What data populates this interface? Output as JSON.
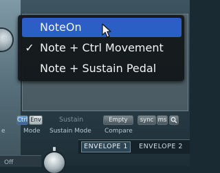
{
  "left_panel": {
    "partial_label": "od"
  },
  "sustain_menu": {
    "items": [
      {
        "label": "NoteOn",
        "checked": false,
        "highlighted": true
      },
      {
        "label": "Note + Ctrl Movement",
        "checked": true,
        "highlighted": false
      },
      {
        "label": "Note + Sustain Pedal",
        "checked": false,
        "highlighted": false
      }
    ],
    "check_glyph": "✓"
  },
  "controls": {
    "ctrl": "Ctrl",
    "env": "Env",
    "sustain": "Sustain",
    "empty": "Empty",
    "sync": "sync",
    "ms": "ms",
    "zoom_icon": "magnifier-icon"
  },
  "labels": {
    "partial": "e",
    "mode": "Mode",
    "sustain_mode": "Sustain Mode",
    "compare": "Compare"
  },
  "envelope_tabs": [
    "ENVELOPE 1",
    "ENVELOPE 2"
  ],
  "off_label": "Off",
  "colors": {
    "highlight": "#2c5fc6",
    "menu_bg": "#12161a",
    "panel": "#2e424c"
  }
}
